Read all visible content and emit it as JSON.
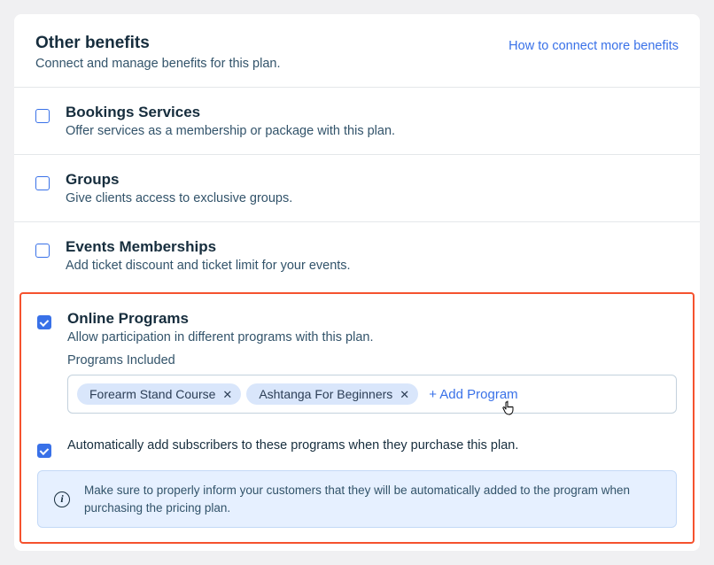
{
  "header": {
    "title": "Other benefits",
    "subtitle": "Connect and manage benefits for this plan.",
    "link": "How to connect more benefits"
  },
  "benefits": {
    "bookings": {
      "title": "Bookings Services",
      "desc": "Offer services as a membership or package with this plan.",
      "checked": false
    },
    "groups": {
      "title": "Groups",
      "desc": "Give clients access to exclusive groups.",
      "checked": false
    },
    "events": {
      "title": "Events Memberships",
      "desc": "Add ticket discount and ticket limit for your events.",
      "checked": false
    },
    "programs": {
      "title": "Online Programs",
      "desc": "Allow participation in different programs with this plan.",
      "checked": true,
      "includedLabel": "Programs Included",
      "chips": [
        "Forearm Stand Course",
        "Ashtanga For Beginners"
      ],
      "addLabel": "+ Add Program",
      "autoAddChecked": true,
      "autoAddText": "Automatically add subscribers to these programs when they purchase this plan.",
      "infoText": "Make sure to properly inform your customers that they will be automatically added to the program when purchasing the pricing plan."
    }
  }
}
